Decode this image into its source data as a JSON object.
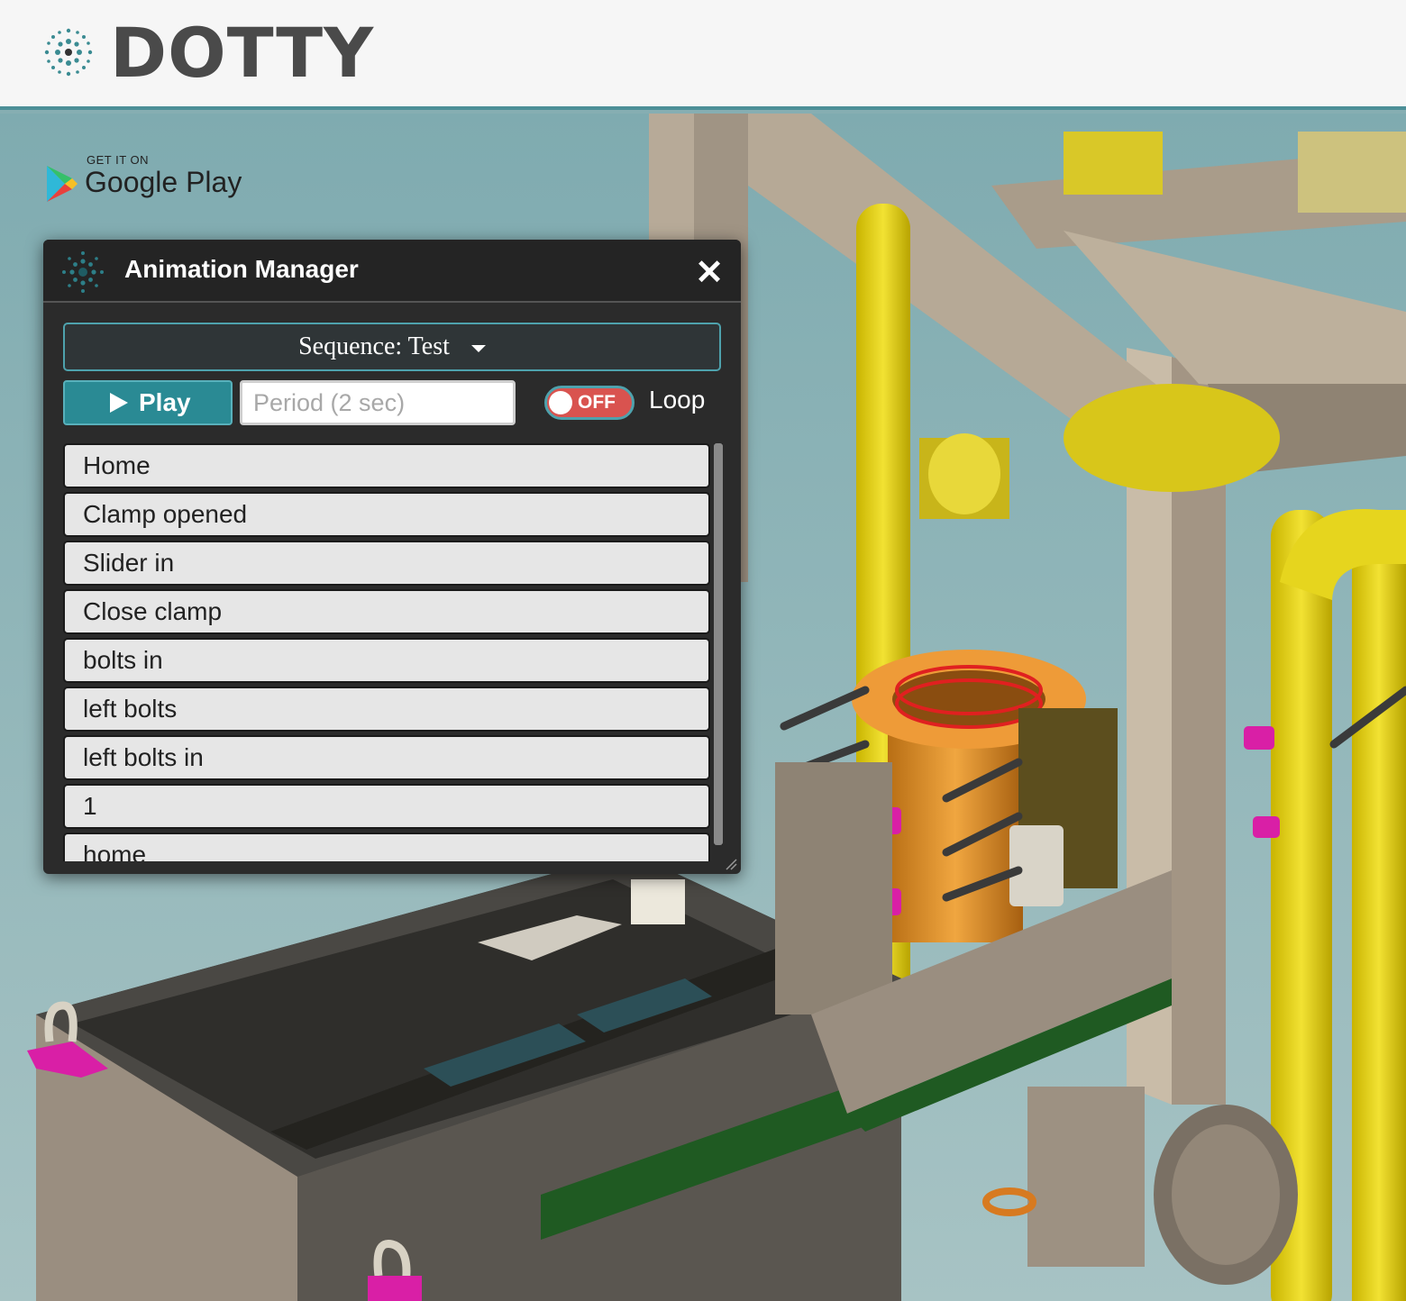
{
  "header": {
    "logo_text": "DOTTY",
    "logo_icon": "dotty-logo-icon"
  },
  "store_badge": {
    "small_text": "GET IT ON",
    "big_text": "Google Play",
    "icon": "google-play-icon"
  },
  "animation_manager": {
    "title": "Animation Manager",
    "close_icon": "close-icon",
    "sequence_label": "Sequence: Test",
    "play_label": "Play",
    "period_placeholder": "Period (2 sec)",
    "loop_state": "OFF",
    "loop_label": "Loop",
    "items": [
      "Home",
      "Clamp opened",
      "Slider in",
      "Close clamp",
      "bolts in",
      "left bolts",
      "left bolts in",
      "1",
      "home"
    ]
  },
  "colors": {
    "accent": "#2a8a94",
    "toggle_off": "#d9534f",
    "panel_bg": "#2b2b2b"
  }
}
